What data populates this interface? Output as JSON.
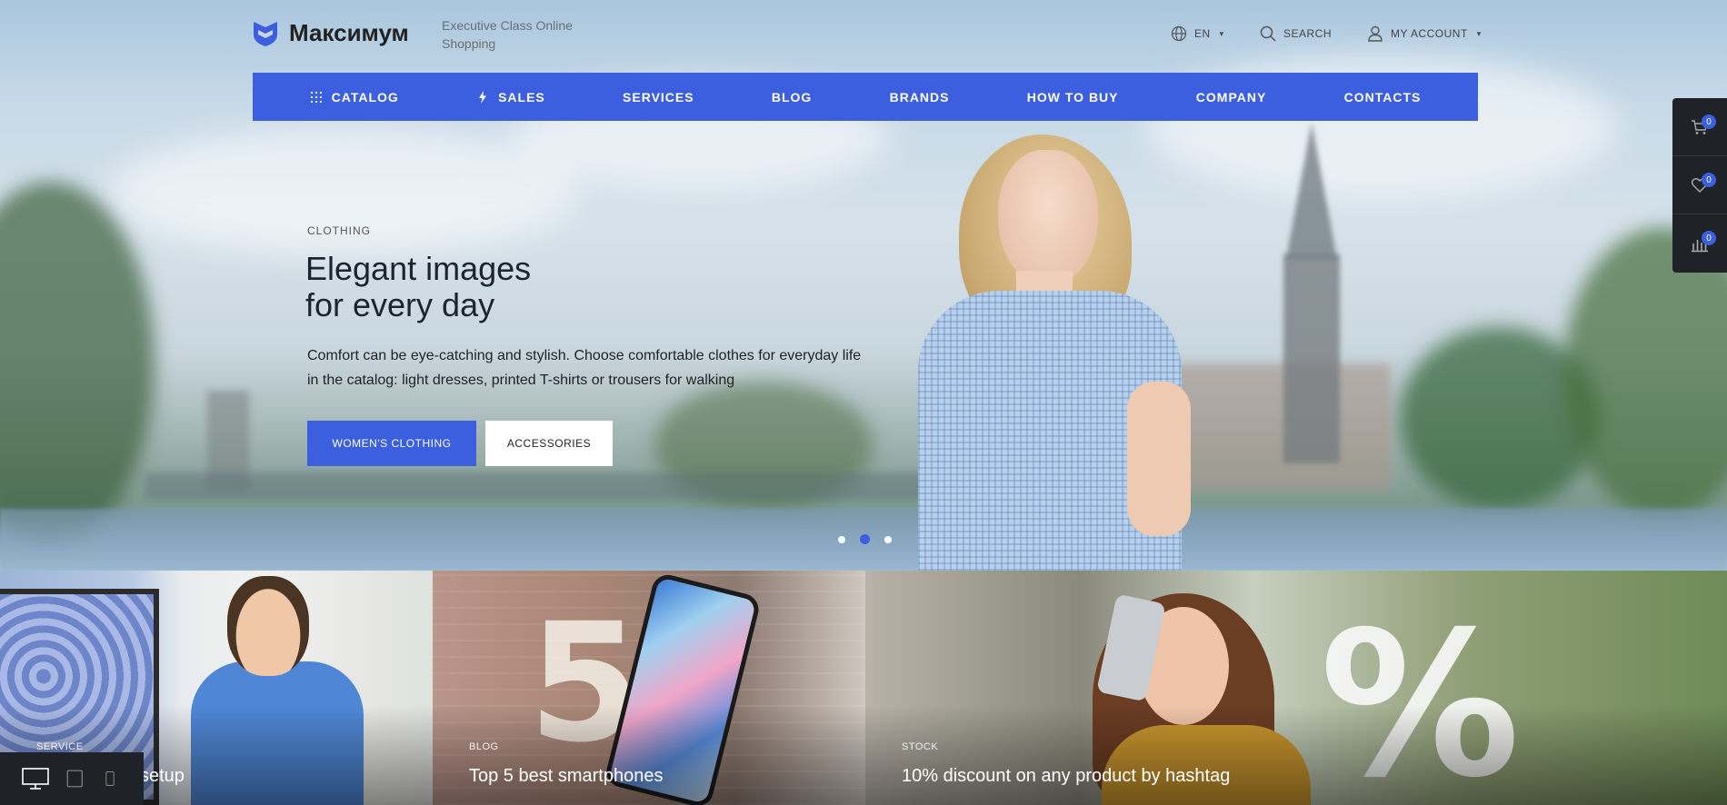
{
  "header": {
    "logo_text": "Максимум",
    "tagline": "Executive Class Online Shopping",
    "language": "EN",
    "search_label": "SEARCH",
    "account_label": "MY ACCOUNT"
  },
  "nav": {
    "items": [
      "CATALOG",
      "SALES",
      "SERVICES",
      "BLOG",
      "BRANDS",
      "HOW TO BUY",
      "COMPANY",
      "CONTACTS"
    ]
  },
  "hero": {
    "category": "CLOTHING",
    "title_line1": "Elegant images",
    "title_line2": "for every day",
    "description": "Comfort can be eye-catching and stylish. Choose comfortable clothes for everyday life in the catalog: light dresses, printed T-shirts or trousers for walking",
    "primary_button": "WOMEN'S CLOTHING",
    "secondary_button": "ACCESSORIES",
    "slide_count": 3,
    "active_slide": 2
  },
  "side_panel": {
    "cart_count": "0",
    "favorites_count": "0",
    "compare_count": "0"
  },
  "banners": [
    {
      "category": "SERVICE",
      "title": "setup"
    },
    {
      "category": "BLOG",
      "title": "Top 5 best smartphones"
    },
    {
      "category": "STOCK",
      "title": "10% discount on any product by hashtag"
    }
  ],
  "colors": {
    "accent": "#3b5fde",
    "dark_panel": "#1f2226"
  },
  "icons": [
    "shield-logo-icon",
    "globe-icon",
    "search-icon",
    "user-icon",
    "grid-icon",
    "lightning-icon",
    "cart-icon",
    "heart-icon",
    "compare-icon",
    "desktop-icon",
    "tablet-icon",
    "mobile-icon"
  ]
}
